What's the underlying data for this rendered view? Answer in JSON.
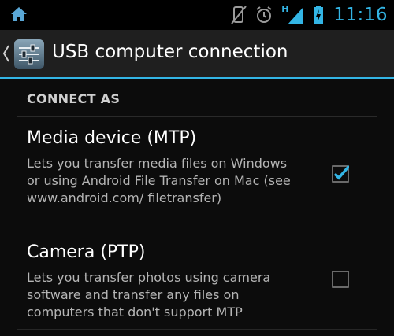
{
  "status_bar": {
    "time": "11:16",
    "network_type": "H",
    "icons": [
      "home-icon",
      "no-sim-vibrate-icon",
      "alarm-clock-icon",
      "signal-icon",
      "battery-charging-icon"
    ],
    "accent_color": "#33b5e5"
  },
  "action_bar": {
    "title": "USB computer connection",
    "icon": "settings-sliders-icon",
    "up_icon": "chevron-left-icon"
  },
  "section": {
    "header": "CONNECT AS"
  },
  "options": [
    {
      "title": "Media device (MTP)",
      "summary": "Lets you transfer media files on Windows or using Android File Transfer on Mac (see www.android.com/ filetransfer)",
      "checked": true
    },
    {
      "title": "Camera (PTP)",
      "summary": "Lets you transfer photos using camera software and transfer any files on computers that don't support MTP",
      "checked": false
    }
  ]
}
